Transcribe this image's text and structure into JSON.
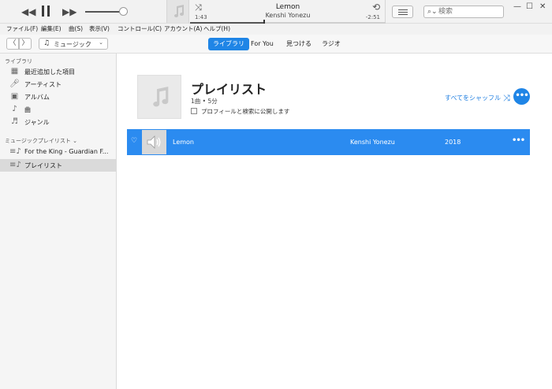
{
  "player": {
    "prev_icon": "rewind-icon",
    "play_icon": "pause-icon",
    "next_icon": "fast-forward-icon",
    "volume_level": 0.88,
    "now_playing": {
      "title": "Lemon",
      "artist": "Kenshi Yonezu",
      "elapsed": "1:43",
      "remaining": "-2:51",
      "progress": 0.38
    }
  },
  "search": {
    "placeholder": "検索"
  },
  "menu": {
    "items": [
      "ファイル(F)",
      "編集(E)",
      "曲(S)",
      "表示(V)",
      "コントロール(C)",
      "アカウント(A)",
      "ヘルプ(H)"
    ]
  },
  "nav": {
    "media_select": "ミュージック",
    "tabs": [
      "ライブラリ",
      "For You",
      "見つける",
      "ラジオ"
    ],
    "active_tab": "ライブラリ"
  },
  "sidebar": {
    "library_header": "ライブラリ",
    "library_items": [
      {
        "label": "最近追加した項目",
        "icon": "grid-icon"
      },
      {
        "label": "アーティスト",
        "icon": "microphone-icon"
      },
      {
        "label": "アルバム",
        "icon": "album-icon"
      },
      {
        "label": "曲",
        "icon": "music-note-icon"
      },
      {
        "label": "ジャンル",
        "icon": "genre-icon"
      }
    ],
    "playlists_header": "ミュージックプレイリスト",
    "playlist_items": [
      {
        "label": "For the King - Guardian F...",
        "icon": "playlist-icon"
      },
      {
        "label": "プレイリスト",
        "icon": "playlist-icon",
        "selected": true
      }
    ]
  },
  "playlist": {
    "title": "プレイリスト",
    "meta": "1曲 • 5分",
    "publish_label": "プロフィールと検索に公開します",
    "shuffle_label": "すべてをシャッフル",
    "tracks": [
      {
        "name": "Lemon",
        "artist": "Kenshi Yonezu",
        "year": "2018"
      }
    ]
  }
}
